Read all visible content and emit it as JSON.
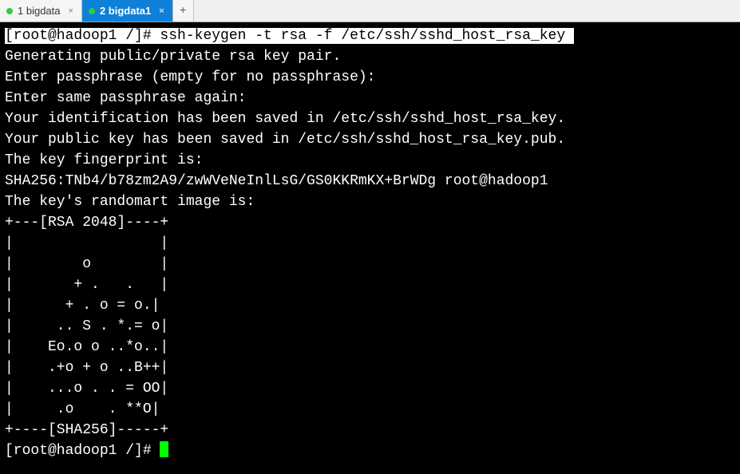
{
  "tabs": {
    "t1": {
      "label": "1 bigdata"
    },
    "t2": {
      "label": "2 bigdata1"
    },
    "new": "+"
  },
  "term": {
    "prompt1_full": "[root@hadoop1 /]# ssh-keygen -t rsa -f /etc/ssh/sshd_host_rsa_key ",
    "l1": "Generating public/private rsa key pair.",
    "l2": "Enter passphrase (empty for no passphrase):",
    "l3": "Enter same passphrase again:",
    "l4": "Your identification has been saved in /etc/ssh/sshd_host_rsa_key.",
    "l5": "Your public key has been saved in /etc/ssh/sshd_host_rsa_key.pub.",
    "l6": "The key fingerprint is:",
    "l7": "SHA256:TNb4/b78zm2A9/zwWVeNeInlLsG/GS0KKRmKX+BrWDg root@hadoop1",
    "l8": "The key's randomart image is:",
    "r0": "+---[RSA 2048]----+",
    "r1": "|                 |",
    "r2": "|        o        |",
    "r3": "|       + .   .   |",
    "r4": "|      + . o = o.|",
    "r5": "|     .. S . *.= o|",
    "r6": "|    Eo.o o ..*o..|",
    "r7": "|    .+o + o ..B++|",
    "r8": "|    ...o . . = OO|",
    "r9": "|     .o    . **O|",
    "r10": "+----[SHA256]-----+",
    "prompt2": "[root@hadoop1 /]# "
  }
}
